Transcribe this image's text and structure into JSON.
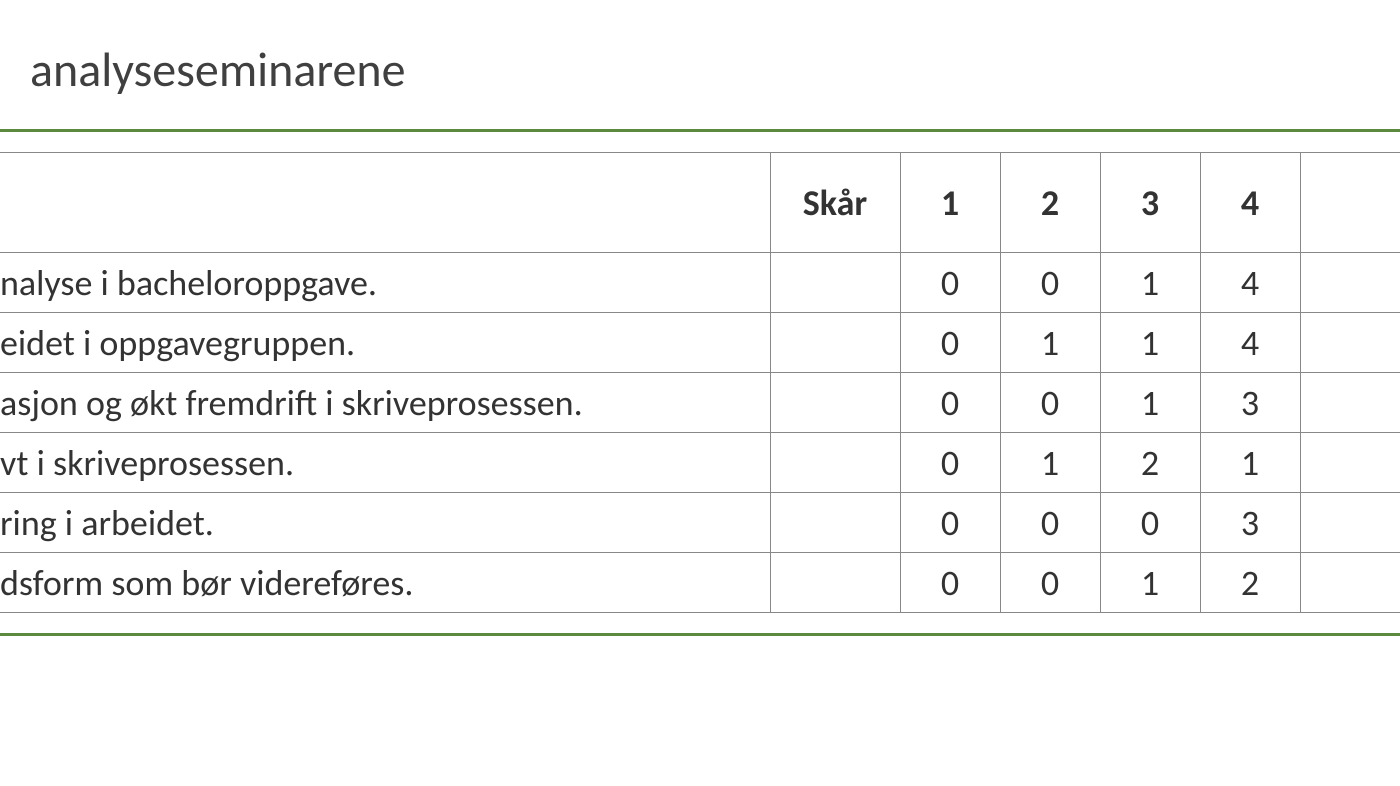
{
  "title": "analyseseminarene",
  "headers": {
    "label": "",
    "skar": "Skår",
    "c1": "1",
    "c2": "2",
    "c3": "3",
    "c4": "4",
    "c5": ""
  },
  "rows": [
    {
      "label": "nalyse i bacheloroppgave.",
      "skar": "",
      "v1": "0",
      "v2": "0",
      "v3": "1",
      "v4": "4",
      "v5": ""
    },
    {
      "label": "eidet i oppgavegruppen.",
      "skar": "",
      "v1": "0",
      "v2": "1",
      "v3": "1",
      "v4": "4",
      "v5": ""
    },
    {
      "label": "asjon og økt fremdrift i skriveprosessen.",
      "skar": "",
      "v1": "0",
      "v2": "0",
      "v3": "1",
      "v4": "3",
      "v5": ""
    },
    {
      "label": "vt i skriveprosessen.",
      "skar": "",
      "v1": "0",
      "v2": "1",
      "v3": "2",
      "v4": "1",
      "v5": ""
    },
    {
      "label": "ring i arbeidet.",
      "skar": "",
      "v1": "0",
      "v2": "0",
      "v3": "0",
      "v4": "3",
      "v5": ""
    },
    {
      "label": "dsform som bør videreføres.",
      "skar": "",
      "v1": "0",
      "v2": "0",
      "v3": "1",
      "v4": "2",
      "v5": ""
    }
  ]
}
